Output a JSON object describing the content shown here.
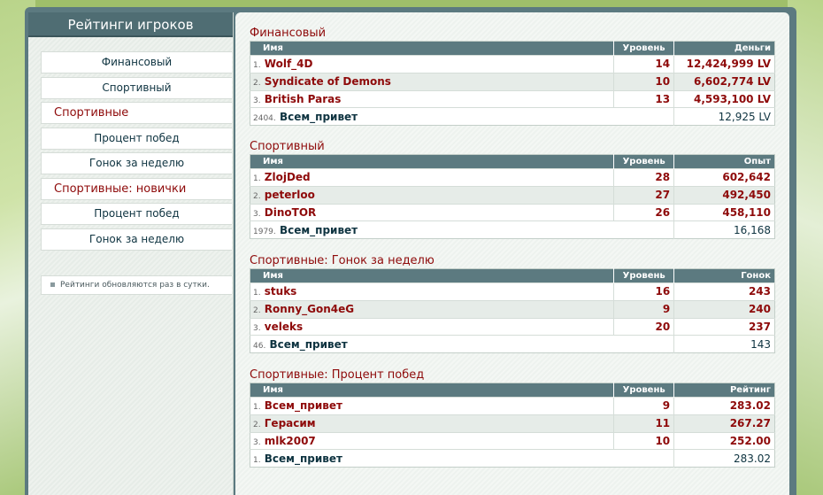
{
  "sidebar": {
    "title": "Рейтинги игроков",
    "items": [
      {
        "label": "Финансовый",
        "type": "item"
      },
      {
        "label": "Спортивный",
        "type": "item"
      },
      {
        "label": "Спортивные",
        "type": "group"
      },
      {
        "label": "Процент побед",
        "type": "item"
      },
      {
        "label": "Гонок за неделю",
        "type": "item"
      },
      {
        "label": "Спортивные: новички",
        "type": "group"
      },
      {
        "label": "Процент побед",
        "type": "item"
      },
      {
        "label": "Гонок за неделю",
        "type": "item"
      }
    ],
    "note": "Рейтинги обновляются раз в сутки."
  },
  "sections": [
    {
      "title": "Финансовый",
      "headers": {
        "name": "Имя",
        "level": "Уровень",
        "value": "Деньги"
      },
      "rows": [
        {
          "rank": "1.",
          "name": "Wolf_4D",
          "level": "14",
          "value": "12,424,999 LV"
        },
        {
          "rank": "2.",
          "name": "Syndicate of Demons",
          "level": "10",
          "value": "6,602,774 LV"
        },
        {
          "rank": "3.",
          "name": "British Paras",
          "level": "13",
          "value": "4,593,100 LV"
        }
      ],
      "me": {
        "rank": "2404.",
        "name": "Всем_привет",
        "level": "",
        "value": "12,925 LV"
      }
    },
    {
      "title": "Спортивный",
      "headers": {
        "name": "Имя",
        "level": "Уровень",
        "value": "Опыт"
      },
      "rows": [
        {
          "rank": "1.",
          "name": "ZlojDed",
          "level": "28",
          "value": "602,642"
        },
        {
          "rank": "2.",
          "name": "peterloo",
          "level": "27",
          "value": "492,450"
        },
        {
          "rank": "3.",
          "name": "DinoTOR",
          "level": "26",
          "value": "458,110"
        }
      ],
      "me": {
        "rank": "1979.",
        "name": "Всем_привет",
        "level": "",
        "value": "16,168"
      }
    },
    {
      "title": "Спортивные: Гонок за неделю",
      "headers": {
        "name": "Имя",
        "level": "Уровень",
        "value": "Гонок"
      },
      "rows": [
        {
          "rank": "1.",
          "name": "stuks",
          "level": "16",
          "value": "243"
        },
        {
          "rank": "2.",
          "name": "Ronny_Gon4eG",
          "level": "9",
          "value": "240"
        },
        {
          "rank": "3.",
          "name": "veleks",
          "level": "20",
          "value": "237"
        }
      ],
      "me": {
        "rank": "46.",
        "name": "Всем_привет",
        "level": "",
        "value": "143"
      }
    },
    {
      "title": "Спортивные: Процент побед",
      "headers": {
        "name": "Имя",
        "level": "Уровень",
        "value": "Рейтинг"
      },
      "rows": [
        {
          "rank": "1.",
          "name": "Всем_привет",
          "level": "9",
          "value": "283.02"
        },
        {
          "rank": "2.",
          "name": "Герасим",
          "level": "11",
          "value": "267.27"
        },
        {
          "rank": "3.",
          "name": "mlk2007",
          "level": "10",
          "value": "252.00"
        }
      ],
      "me": {
        "rank": "1.",
        "name": "Всем_привет",
        "level": "",
        "value": "283.02"
      }
    }
  ]
}
